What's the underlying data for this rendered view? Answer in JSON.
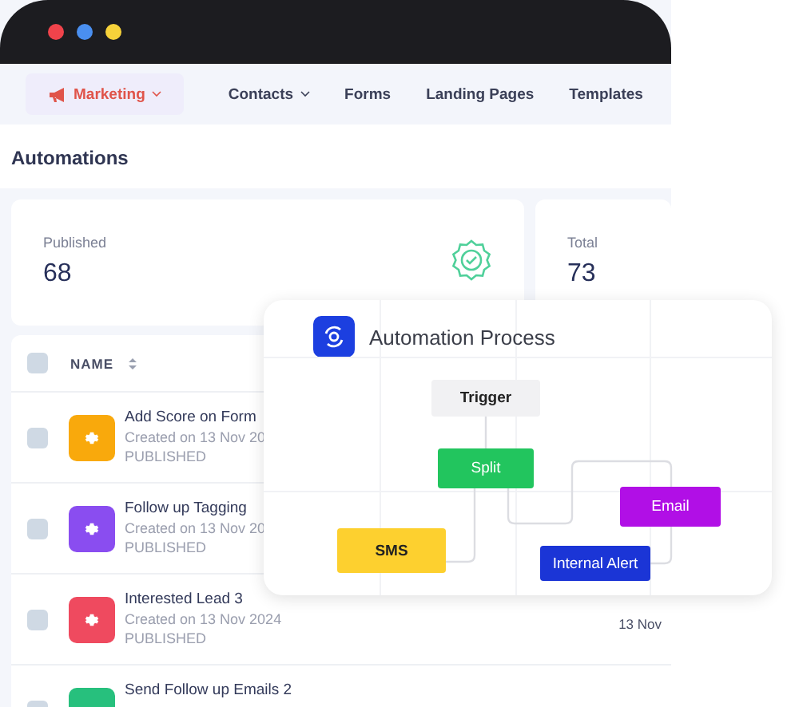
{
  "browser": {
    "dots": [
      {
        "color": "#f0434b"
      },
      {
        "color": "#4a8ff0"
      },
      {
        "color": "#f7d23a"
      }
    ]
  },
  "nav": {
    "items": [
      {
        "label": "Marketing",
        "selected": true,
        "dropdown": true
      },
      {
        "label": "Contacts",
        "selected": false,
        "dropdown": true
      },
      {
        "label": "Forms",
        "selected": false,
        "dropdown": false
      },
      {
        "label": "Landing Pages",
        "selected": false,
        "dropdown": false
      },
      {
        "label": "Templates",
        "selected": false,
        "dropdown": false
      }
    ]
  },
  "page_title": "Automations",
  "stats": [
    {
      "label": "Published",
      "value": "68"
    },
    {
      "label": "Total",
      "value": "73"
    }
  ],
  "table": {
    "select_all_checked": false,
    "columns": [
      {
        "label": "NAME",
        "sortable": true
      }
    ],
    "rows": [
      {
        "name": "Add Score on Form",
        "created": "Created on 13 Nov 20",
        "status": "PUBLISHED",
        "color": "#f9a90c",
        "checked": false
      },
      {
        "name": "Follow up Tagging",
        "created": "Created on 13 Nov 20",
        "status": "PUBLISHED",
        "color": "#8a4df0",
        "checked": false
      },
      {
        "name": "Interested Lead 3",
        "created": "Created on 13 Nov 2024",
        "status": "PUBLISHED",
        "color": "#ef4a5f",
        "checked": false,
        "date": "13 Nov"
      },
      {
        "name": "Send Follow up Emails 2",
        "color": "#27c07d",
        "checked": false
      }
    ]
  },
  "overlay": {
    "title": "Automation Process",
    "nodes": [
      {
        "label": "Trigger",
        "color": "#f1f1f3"
      },
      {
        "label": "Split",
        "color": "#22c55e"
      },
      {
        "label": "SMS",
        "color": "#fdd02f"
      },
      {
        "label": "Email",
        "color": "#b10fe6"
      },
      {
        "label": "Internal Alert",
        "color": "#1b35d6"
      }
    ]
  }
}
